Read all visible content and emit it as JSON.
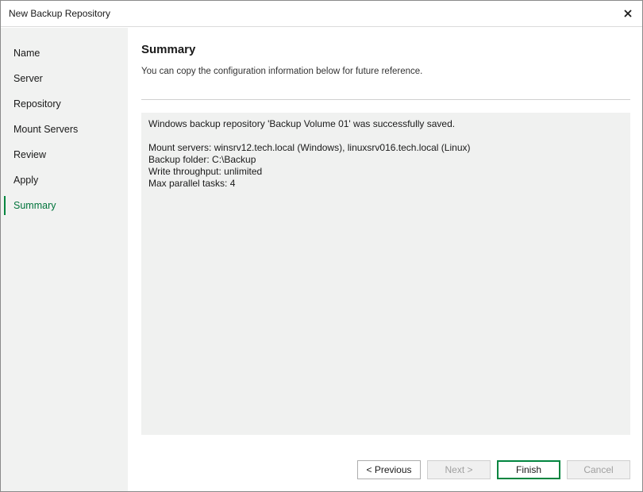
{
  "window": {
    "title": "New Backup Repository",
    "close_icon": "close-icon"
  },
  "sidebar": {
    "items": [
      {
        "label": "Name",
        "active": false
      },
      {
        "label": "Server",
        "active": false
      },
      {
        "label": "Repository",
        "active": false
      },
      {
        "label": "Mount Servers",
        "active": false
      },
      {
        "label": "Review",
        "active": false
      },
      {
        "label": "Apply",
        "active": false
      },
      {
        "label": "Summary",
        "active": true
      }
    ]
  },
  "main": {
    "title": "Summary",
    "subtitle": "You can copy the configuration information below for future reference.",
    "summary": {
      "saved_message": "Windows backup repository 'Backup Volume 01' was successfully saved.",
      "mount_servers": "Mount servers: winsrv12.tech.local (Windows), linuxsrv016.tech.local (Linux)",
      "backup_folder": "Backup folder: C:\\Backup",
      "write_throughput": "Write throughput: unlimited",
      "max_parallel_tasks": "Max parallel tasks: 4"
    }
  },
  "footer": {
    "previous_label": "< Previous",
    "next_label": "Next >",
    "finish_label": "Finish",
    "cancel_label": "Cancel"
  },
  "colors": {
    "accent": "#00853f",
    "active_text": "#00743b",
    "sidebar_bg": "#f1f2f1",
    "summary_bg": "#f0f1f0"
  }
}
